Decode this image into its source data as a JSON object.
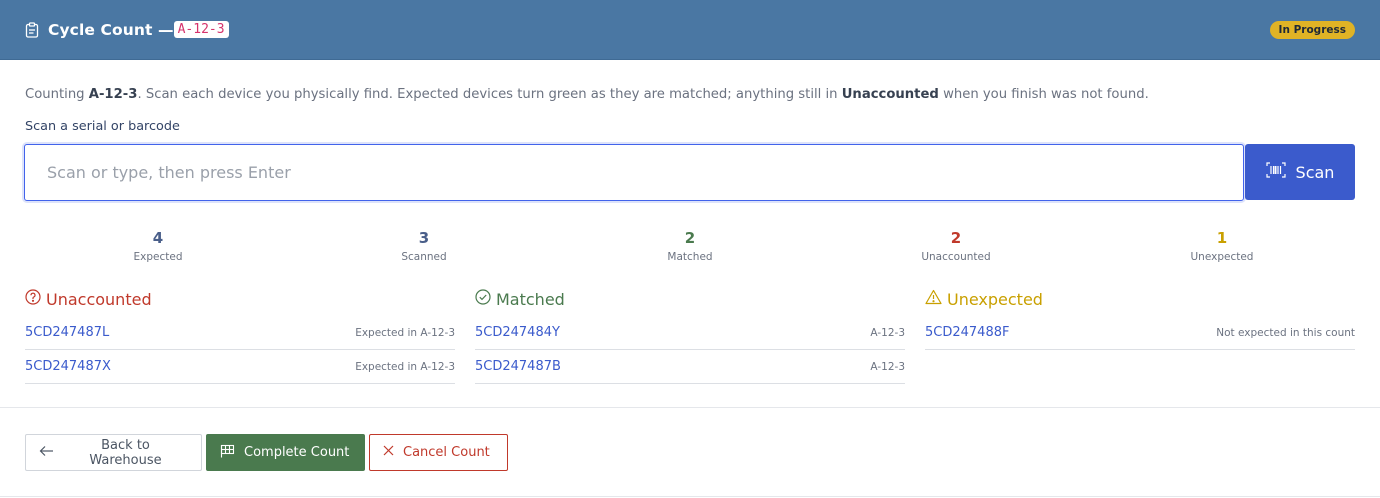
{
  "header": {
    "title": "Cycle Count —",
    "location_code": "A-12-3",
    "status_badge": "In Progress",
    "colors": {
      "bar": "#4a77a3",
      "badge": "#e0b325"
    }
  },
  "intro": {
    "p1": "Counting ",
    "location": "A-12-3",
    "p2": ". Scan each device you physically find. Expected devices turn green as they are matched; anything still in ",
    "keyword": "Unaccounted",
    "p3": " when you finish was not found."
  },
  "scan": {
    "label": "Scan a serial or barcode",
    "placeholder": "Scan or type, then press Enter",
    "value": "",
    "button_label": "Scan",
    "button_icon": "barcode-icon"
  },
  "stats": [
    {
      "value": "4",
      "label": "Expected",
      "color": "#4a5f8a"
    },
    {
      "value": "3",
      "label": "Scanned",
      "color": "#4a5f8a"
    },
    {
      "value": "2",
      "label": "Matched",
      "color": "#4a7a4e"
    },
    {
      "value": "2",
      "label": "Unaccounted",
      "color": "#c0392b"
    },
    {
      "value": "1",
      "label": "Unexpected",
      "color": "#c9a000"
    }
  ],
  "columns": {
    "unaccounted": {
      "title": "Unaccounted",
      "icon": "question-circle-icon",
      "color": "#c0392b",
      "items": [
        {
          "serial": "5CD247487L",
          "note": "Expected in A-12-3"
        },
        {
          "serial": "5CD247487X",
          "note": "Expected in A-12-3"
        }
      ]
    },
    "matched": {
      "title": "Matched",
      "icon": "check-circle-icon",
      "color": "#4a7a4e",
      "items": [
        {
          "serial": "5CD247484Y",
          "note": "A-12-3"
        },
        {
          "serial": "5CD247487B",
          "note": "A-12-3"
        }
      ]
    },
    "unexpected": {
      "title": "Unexpected",
      "icon": "warning-triangle-icon",
      "color": "#c9a000",
      "items": [
        {
          "serial": "5CD247488F",
          "note": "Not expected in this count"
        }
      ]
    }
  },
  "actions": {
    "back": "Back to Warehouse",
    "complete": "Complete Count",
    "cancel": "Cancel Count"
  }
}
